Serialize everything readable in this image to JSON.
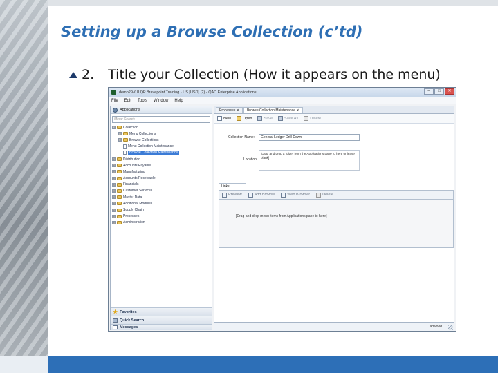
{
  "slide": {
    "title": "Setting up a Browse Collection (c’td)",
    "bullet_number": "2.",
    "bullet_text": "Title your Collection (How it appears on the menu)",
    "colors": {
      "title": "#2e6fb4",
      "bottom_band": "#2d6fb7"
    }
  },
  "app": {
    "window_title": "demo29VUI QP Bravepoint Training - US [USD] (2) - QAD Enterprise Applications",
    "minimize_label": "–",
    "maximize_label": "□",
    "close_label": "✕",
    "menu": [
      "File",
      "Edit",
      "Tools",
      "Window",
      "Help"
    ],
    "left_panel": {
      "header": "Applications",
      "search_placeholder": "Menu Search",
      "tree": [
        {
          "label": "Collection",
          "level": 0,
          "toggle": "⊟",
          "icon": "folder"
        },
        {
          "label": "Menu Collections",
          "level": 1,
          "toggle": "⊞",
          "icon": "folder"
        },
        {
          "label": "Browse Collections",
          "level": 1,
          "toggle": "⊞",
          "icon": "folder"
        },
        {
          "label": "Menu Collection Maintenance",
          "level": 1,
          "toggle": "",
          "icon": "doc"
        },
        {
          "label": "Browse Collection Maintenance",
          "level": 1,
          "toggle": "",
          "icon": "doc",
          "selected": true
        },
        {
          "label": "Distribution",
          "level": 0,
          "toggle": "⊞",
          "icon": "folder"
        },
        {
          "label": "Accounts Payable",
          "level": 0,
          "toggle": "⊞",
          "icon": "folder"
        },
        {
          "label": "Manufacturing",
          "level": 0,
          "toggle": "⊞",
          "icon": "folder"
        },
        {
          "label": "Accounts Receivable",
          "level": 0,
          "toggle": "⊞",
          "icon": "folder"
        },
        {
          "label": "Financials",
          "level": 0,
          "toggle": "⊞",
          "icon": "folder"
        },
        {
          "label": "Customer Services",
          "level": 0,
          "toggle": "⊞",
          "icon": "folder"
        },
        {
          "label": "Master Data",
          "level": 0,
          "toggle": "⊞",
          "icon": "folder"
        },
        {
          "label": "Additional Modules",
          "level": 0,
          "toggle": "⊞",
          "icon": "folder"
        },
        {
          "label": "Supply Chain",
          "level": 0,
          "toggle": "⊞",
          "icon": "folder"
        },
        {
          "label": "Processes",
          "level": 0,
          "toggle": "⊞",
          "icon": "folder"
        },
        {
          "label": "Administration",
          "level": 0,
          "toggle": "⊞",
          "icon": "folder"
        }
      ],
      "favorites": "Favorites",
      "quick_search": "Quick Search",
      "messages": "Messages"
    },
    "tabs": [
      {
        "label": "Processes",
        "close": "✕"
      },
      {
        "label": "Browse Collection Maintenance",
        "close": "✕",
        "active": true
      }
    ],
    "toolbar": {
      "new": "New",
      "open": "Open",
      "save": "Save",
      "save_as": "Save As",
      "delete": "Delete"
    },
    "form": {
      "collection_name_label": "Collection Name:",
      "collection_name_value": "General Ledger Drill-Down",
      "location_label": "Location:",
      "location_hint": "[Drag and drop a folder from the Applications pane to here or leave blank]"
    },
    "links": {
      "tab": "Links",
      "preview": "Preview",
      "add_browse": "Add Browse",
      "web_browser": "Web Browser",
      "delete": "Delete",
      "hint": "[Drag-and-drop menu items from Applications pane to here]"
    },
    "status": "adwood"
  }
}
